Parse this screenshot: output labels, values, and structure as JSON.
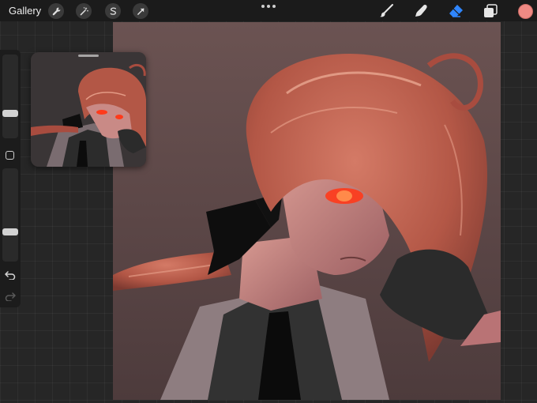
{
  "toolbar": {
    "gallery_label": "Gallery",
    "actions": [
      {
        "name": "wrench-icon"
      },
      {
        "name": "magic-wand-icon"
      },
      {
        "name": "selection-icon"
      },
      {
        "name": "transform-arrow-icon"
      }
    ],
    "tools": [
      {
        "name": "brush-icon"
      },
      {
        "name": "smudge-icon"
      },
      {
        "name": "eraser-icon",
        "active": true
      },
      {
        "name": "layers-icon"
      }
    ],
    "current_color": "#f08a84",
    "accent_color": "#2f86ff"
  },
  "sidebar": {
    "brush_size_level": 0.28,
    "opacity_level": 0.3,
    "buttons": [
      "modify-button",
      "undo-icon",
      "redo-icon"
    ]
  },
  "canvas": {
    "background_color": "#5e4848",
    "colors": {
      "hair": "#b8564a",
      "hair_highlight": "#e39a85",
      "skin": "#c98a86",
      "shirt": "#323232",
      "vest": "#8e7d80",
      "bow": "#0e0e0e",
      "glove": "#2b2b2b",
      "eye": "#ff3a1a"
    }
  },
  "reference_window": {
    "visible": true
  }
}
